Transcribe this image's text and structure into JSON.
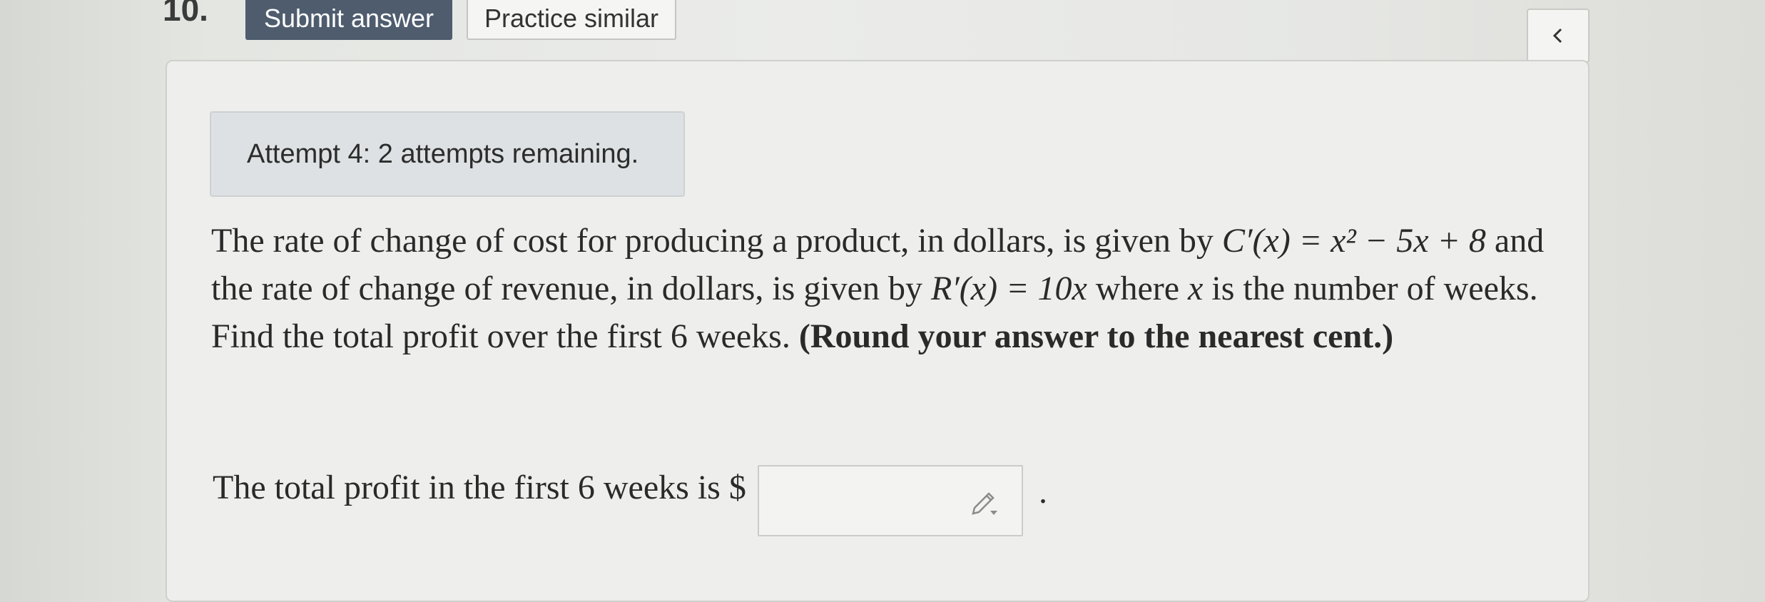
{
  "header": {
    "question_number": "10.",
    "submit_label": "Submit answer",
    "practice_label": "Practice similar",
    "back_icon": "chevron-left-icon"
  },
  "attempt": {
    "text": "Attempt 4: 2 attempts remaining."
  },
  "question": {
    "part1": "The rate of change of cost for producing a product, in dollars, is given by ",
    "cost_formula": "C′(x) = x² − 5x + 8",
    "part2": " and the rate of change of revenue, in dollars, is given by ",
    "revenue_formula": "R′(x) = 10x",
    "part3": " where ",
    "variable": "x",
    "part4": " is the number of weeks. Find the total profit over the first 6 weeks. ",
    "instruction": "(Round your answer to the nearest cent.)"
  },
  "answer": {
    "prompt": "The total profit in the first 6 weeks is $",
    "value": "",
    "edit_icon": "pencil-icon",
    "trailing": "."
  }
}
